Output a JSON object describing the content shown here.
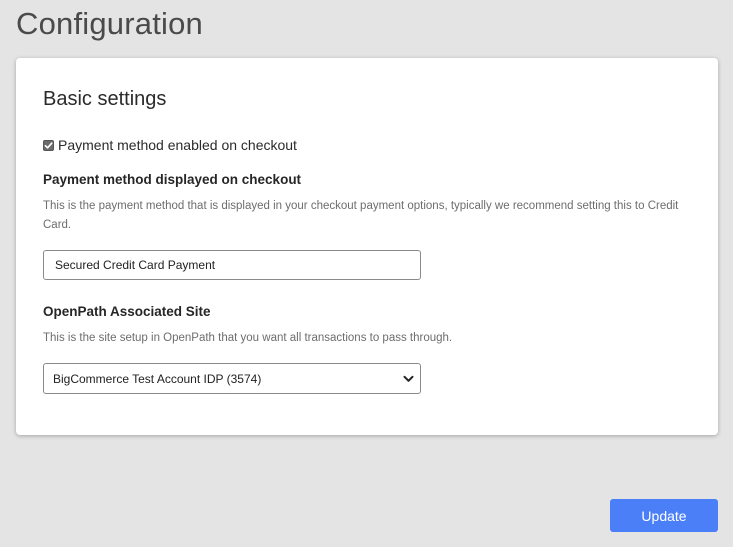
{
  "page": {
    "title": "Configuration"
  },
  "basic_settings": {
    "title": "Basic settings",
    "enabled_checkbox": {
      "label": "Payment method enabled on checkout",
      "checked": true
    },
    "display_name": {
      "label": "Payment method displayed on checkout",
      "help": "This is the payment method that is displayed in your checkout payment options, typically we recommend setting this to Credit Card.",
      "value": "Secured Credit Card Payment"
    },
    "associated_site": {
      "label": "OpenPath Associated Site",
      "help": "This is the site setup in OpenPath that you want all transactions to pass through.",
      "selected": "BigCommerce Test Account IDP (3574)"
    }
  },
  "actions": {
    "update_label": "Update"
  },
  "colors": {
    "page_bg": "#e4e4e4",
    "card_bg": "#ffffff",
    "accent": "#4a7ff7"
  },
  "icons": {
    "checkbox": "check-icon",
    "select": "chevron-down-icon"
  }
}
